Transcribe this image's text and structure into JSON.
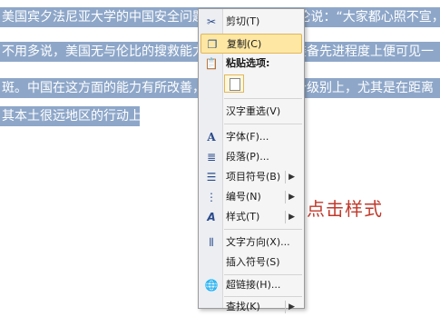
{
  "document": {
    "lines": [
      "美国宾夕法尼亚大学的中国安全问题专家阿瑟·沃尔德伦说：“大家都心照不宣，",
      "不用多说，美国无与伦比的搜救能力反映了美国舰队装备先进程度上便可见一",
      "斑。中国在这方面的能力有所改善，但还没有达到那个级别上，尤其是在距离",
      "其本土很远地区的行动上。"
    ],
    "paragraph_mark": "↵"
  },
  "annotation": "点击样式",
  "context_menu": {
    "items": [
      {
        "label": "剪切(T)",
        "icon": "scissors-icon"
      },
      {
        "label": "复制(C)",
        "icon": "copy-icon"
      },
      {
        "label": "粘贴选项:",
        "icon": "clipboard-icon"
      },
      {
        "label": "汉字重选(V)",
        "icon": ""
      },
      {
        "label": "字体(F)...",
        "icon": "font-icon"
      },
      {
        "label": "段落(P)...",
        "icon": "paragraph-icon"
      },
      {
        "label": "项目符号(B)",
        "icon": "bullets-icon",
        "submenu": "▶"
      },
      {
        "label": "编号(N)",
        "icon": "numbering-icon",
        "submenu": "▶"
      },
      {
        "label": "样式(T)",
        "icon": "styles-icon",
        "submenu": "▶"
      },
      {
        "label": "文字方向(X)...",
        "icon": "text-direction-icon"
      },
      {
        "label": "插入符号(S)",
        "icon": ""
      },
      {
        "label": "超链接(H)...",
        "icon": "hyperlink-icon"
      },
      {
        "label": "查找(K)",
        "icon": "",
        "submenu": "▶"
      }
    ],
    "highlighted": "复制(C)"
  }
}
